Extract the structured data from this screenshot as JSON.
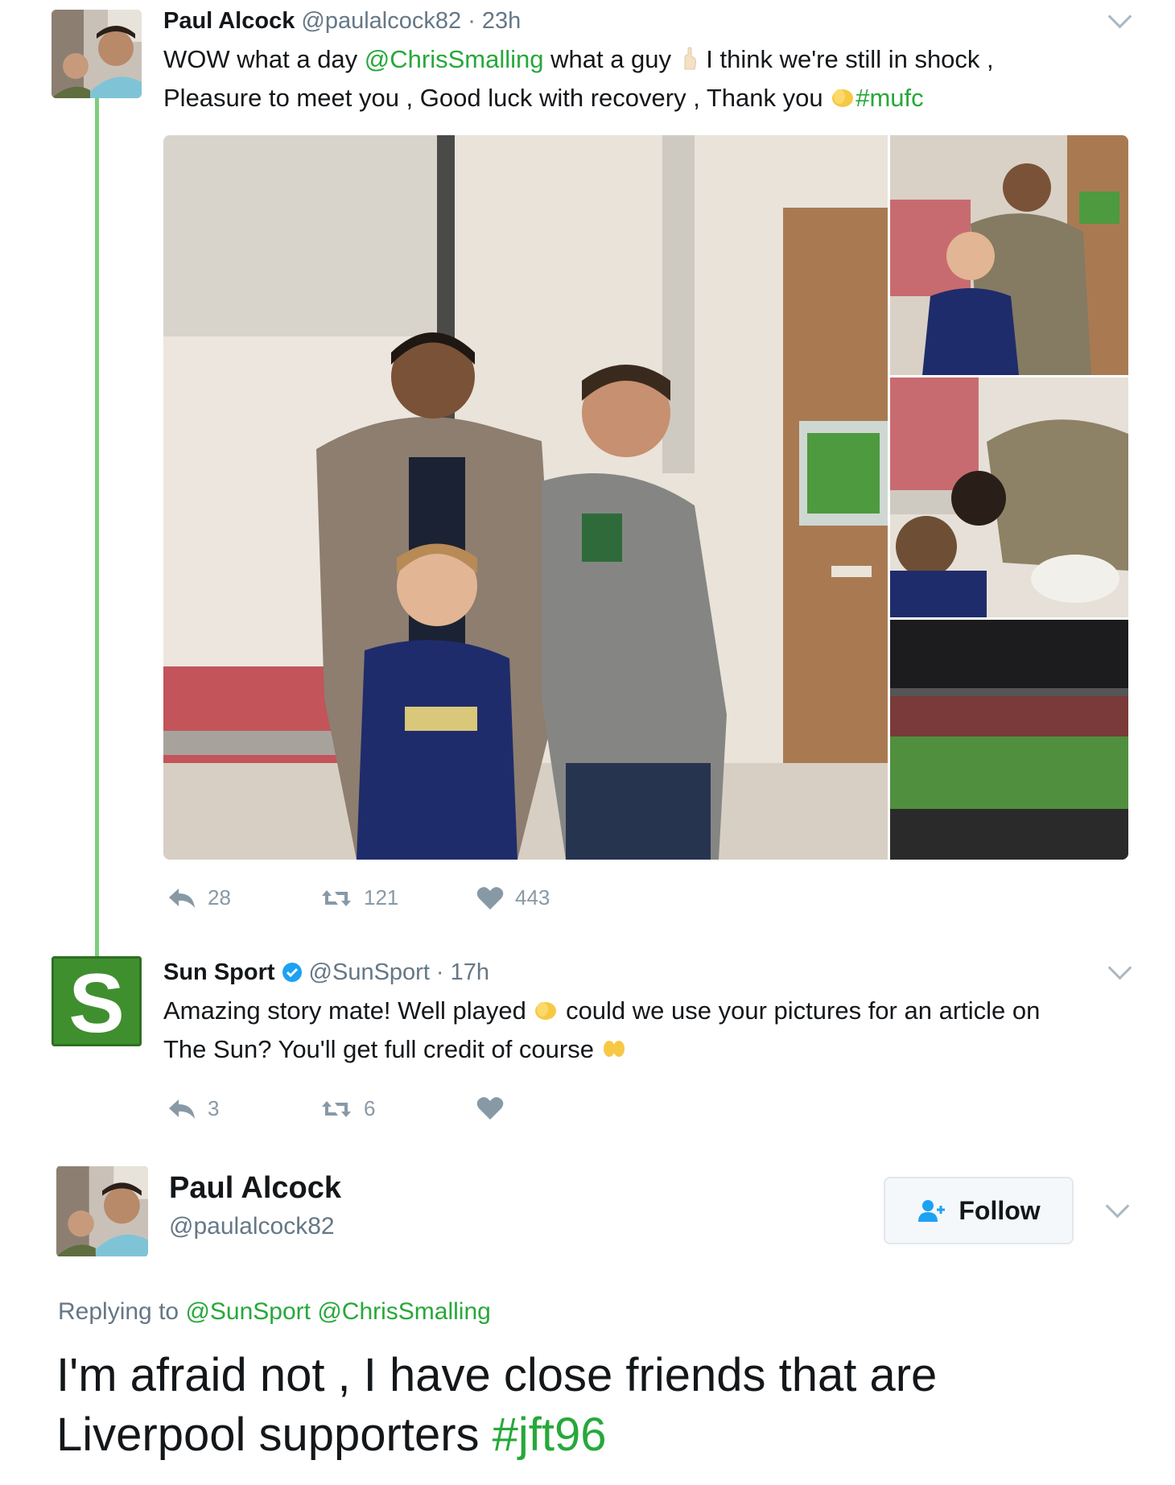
{
  "tweet1": {
    "name": "Paul Alcock",
    "handle": "@paulalcock82",
    "time": "· 23h",
    "line1_a": "WOW what a day ",
    "line1_mention": "@ChrisSmalling",
    "line1_b": " what a guy ",
    "line1_c": " I think we're still in shock ,",
    "line2_a": "Pleasure to meet you , Good luck with recovery , Thank you ",
    "line2_hashtag": "#mufc",
    "replies": "28",
    "retweets": "121",
    "likes": "443"
  },
  "tweet2": {
    "name": "Sun Sport",
    "handle": "@SunSport",
    "time": "· 17h",
    "logo_letter": "S",
    "line1_a": "Amazing story mate! Well played ",
    "line1_b": " could we use your pictures for an article on",
    "line2": "The Sun? You'll get full credit of course ",
    "replies": "3",
    "retweets": "6"
  },
  "tweet3": {
    "name": "Paul Alcock",
    "handle": "@paulalcock82",
    "follow_label": "Follow",
    "replying_label": "Replying to ",
    "replying_to_1": "@SunSport",
    "replying_to_2": "@ChrisSmalling",
    "body_line1": "I'm afraid not , I have close friends that are",
    "body_line2_a": "Liverpool supporters ",
    "body_hashtag": "#jft96"
  },
  "colors": {
    "link": "#27a83a",
    "thread": "#7ccf7c",
    "muted": "#8899a6"
  },
  "icons": [
    "reply-icon",
    "retweet-icon",
    "heart-icon",
    "verified-icon",
    "clapping-hands-icon",
    "raised-hands-icon",
    "add-user-icon",
    "chevron-down-icon"
  ]
}
